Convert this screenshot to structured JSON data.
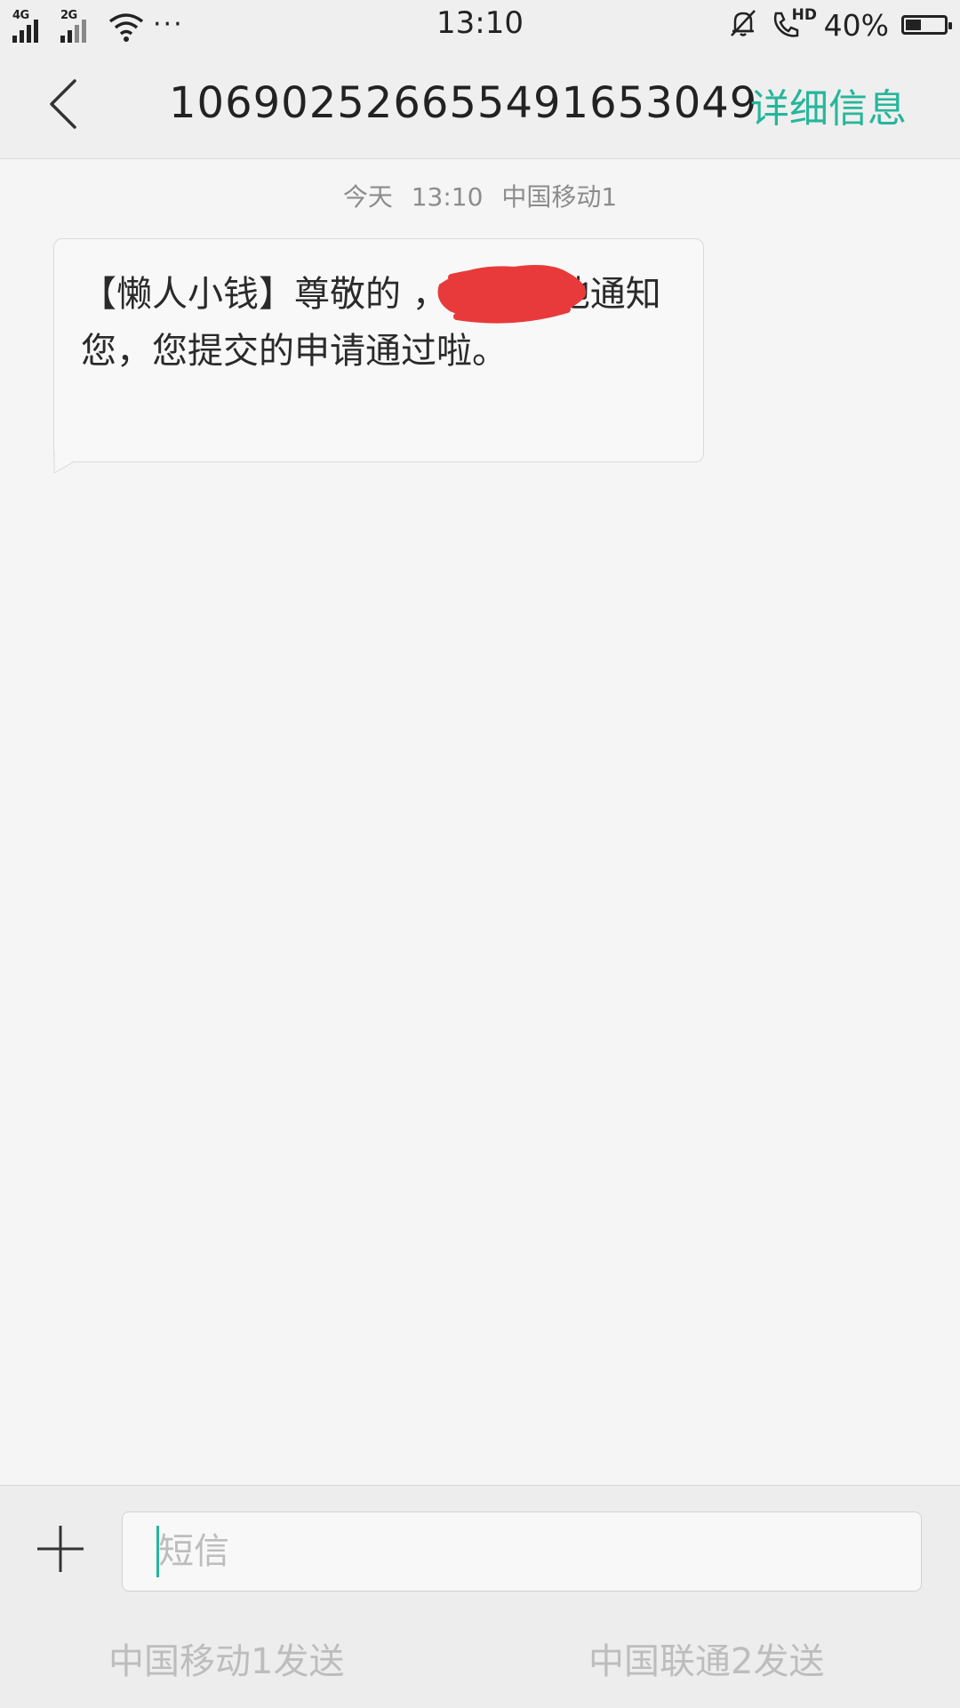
{
  "status_bar": {
    "signal_1_label": "4G",
    "signal_2_label": "2G",
    "more_label": "···",
    "time": "13:10",
    "call_badge": "HD",
    "battery_percent": "40%",
    "battery_level": 0.4,
    "icons": [
      "signal-icon",
      "wifi-icon",
      "bell-muted-icon",
      "hd-call-icon",
      "battery-icon"
    ]
  },
  "header": {
    "title": "106902526655491653049",
    "detail_label": "详细信息",
    "accent_color": "#26b69b"
  },
  "conversation": {
    "meta": {
      "day": "今天",
      "time": "13:10",
      "sim": "中国移动1"
    },
    "messages": [
      {
        "text": "【懒人小钱】尊敬的                    ，很高兴地通知您，您提交的申请通过啦。"
      }
    ]
  },
  "composer": {
    "placeholder": "短信",
    "value": "",
    "send_sim1_label": "中国移动1发送",
    "send_sim2_label": "中国联通2发送"
  },
  "colors": {
    "redaction": "#e83a3a",
    "background": "#f5f5f5"
  }
}
